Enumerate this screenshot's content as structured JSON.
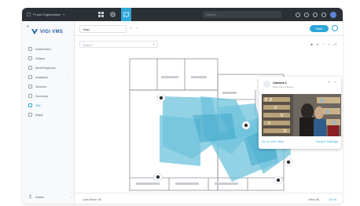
{
  "topbar": {
    "org_name": "Pl and Organization",
    "search_placeholder": "Search",
    "icons": [
      "grid-icon",
      "settings-icon",
      "map-icon"
    ]
  },
  "sidebar": {
    "logo": "VIGI VMS",
    "items": [
      {
        "label": "Dashboard",
        "icon": "dashboard-icon"
      },
      {
        "label": "Videos",
        "icon": "video-icon"
      },
      {
        "label": "Alert/Playback",
        "icon": "alert-icon"
      },
      {
        "label": "Analytics",
        "icon": "analytics-icon"
      },
      {
        "label": "Devices",
        "icon": "devices-icon"
      },
      {
        "label": "Doorway",
        "icon": "door-icon"
      },
      {
        "label": "Site",
        "icon": "site-icon"
      },
      {
        "label": "Maps",
        "icon": "maps-icon"
      }
    ],
    "active_index": 6,
    "footer_label": "Admin"
  },
  "content": {
    "tab_label": "Map",
    "tab_close": "×",
    "tab_add": "+",
    "new_button": "New",
    "search_placeholder": "Search",
    "footer_left": "Last Move 00",
    "footer_right_1": "View All",
    "footer_right_2": "Go to"
  },
  "camera_card": {
    "title": "Camera 1",
    "subtitle": "Store Floor Camera",
    "action_left": "Go to Live View",
    "action_right": "Device Settings"
  },
  "colors": {
    "accent": "#2fa7d9",
    "topbar": "#2b3036",
    "coverage": "#6fc3dc",
    "coverage_dark": "#3aa3c7"
  }
}
